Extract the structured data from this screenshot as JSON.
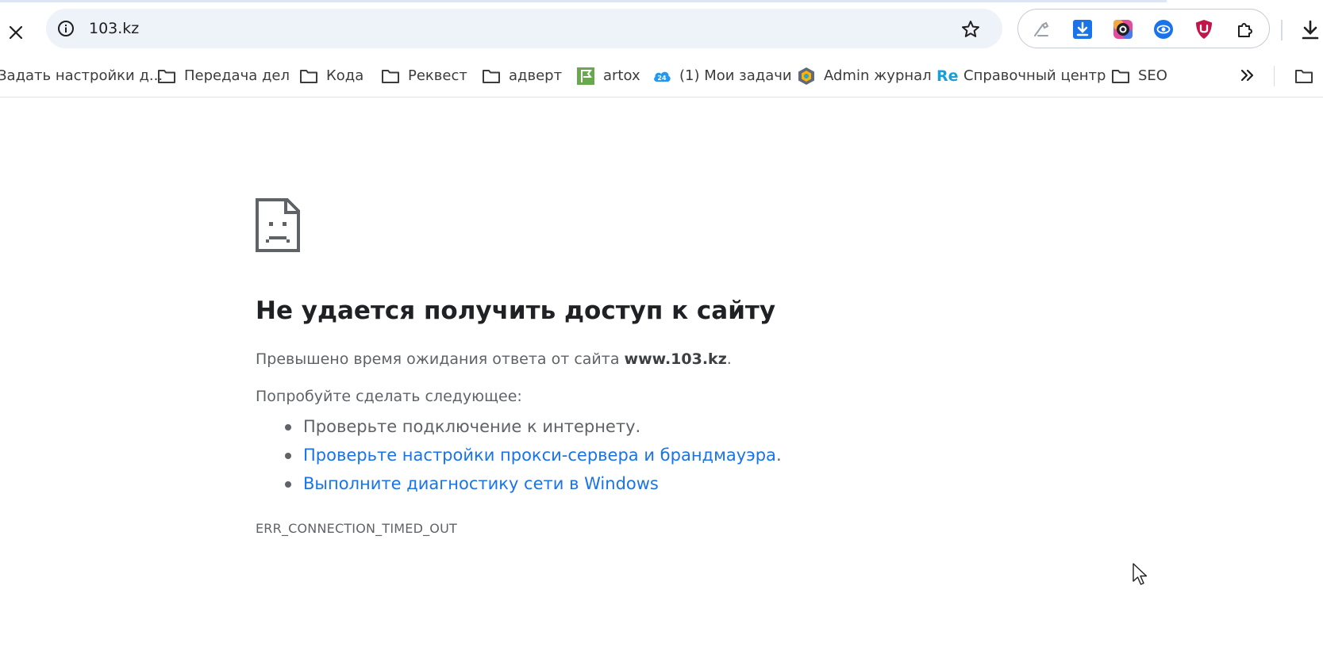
{
  "browser": {
    "url": "103.kz",
    "close_icon": "close-icon",
    "site_info_icon": "info-icon",
    "bookmark_star_icon": "star-icon",
    "extensions": [
      {
        "name": "pen-tool-extension",
        "icon": "pen-icon"
      },
      {
        "name": "download-extension",
        "icon": "download-arrow-icon"
      },
      {
        "name": "color-picker-extension",
        "icon": "color-wheel-icon"
      },
      {
        "name": "eye-extension",
        "icon": "eye-icon"
      },
      {
        "name": "shield-extension",
        "icon": "shield-u-icon"
      },
      {
        "name": "extensions-menu",
        "icon": "puzzle-icon"
      }
    ],
    "colors": {
      "link": "#1a73e8",
      "omnibox_bg": "#eef2f9",
      "heading": "#202124",
      "body_text": "#5f6368"
    }
  },
  "bookmarks": [
    {
      "label": "Задать настройки д...",
      "icon": "none"
    },
    {
      "label": "Передача дел",
      "icon": "folder-icon"
    },
    {
      "label": "Кода",
      "icon": "folder-icon"
    },
    {
      "label": "Реквест",
      "icon": "folder-icon"
    },
    {
      "label": "адверт",
      "icon": "folder-icon"
    },
    {
      "label": "artox",
      "icon": "green-flag-icon"
    },
    {
      "label": "(1) Мои задачи",
      "icon": "bitrix24-icon"
    },
    {
      "label": "Admin журнал",
      "icon": "admin-logo-icon"
    },
    {
      "label": "Справочный центр",
      "icon": "re-logo-icon"
    },
    {
      "label": "SEO",
      "icon": "folder-icon"
    }
  ],
  "bookmarks_24_badge": "24",
  "bookmarks_re_badge": "Re",
  "error_page": {
    "icon": "sad-page-icon",
    "title": "Не удается получить доступ к сайту",
    "message_prefix": "Превышено время ожидания ответа от сайта ",
    "message_host": "www.103.kz",
    "message_suffix": ".",
    "try_label": "Попробуйте сделать следующее:",
    "suggestion_1": "Проверьте подключение к интернету.",
    "suggestion_2": "Проверьте настройки прокси-сервера и брандмауэра",
    "suggestion_2_suffix": ".",
    "suggestion_3": "Выполните диагностику сети в Windows",
    "error_code": "ERR_CONNECTION_TIMED_OUT"
  }
}
